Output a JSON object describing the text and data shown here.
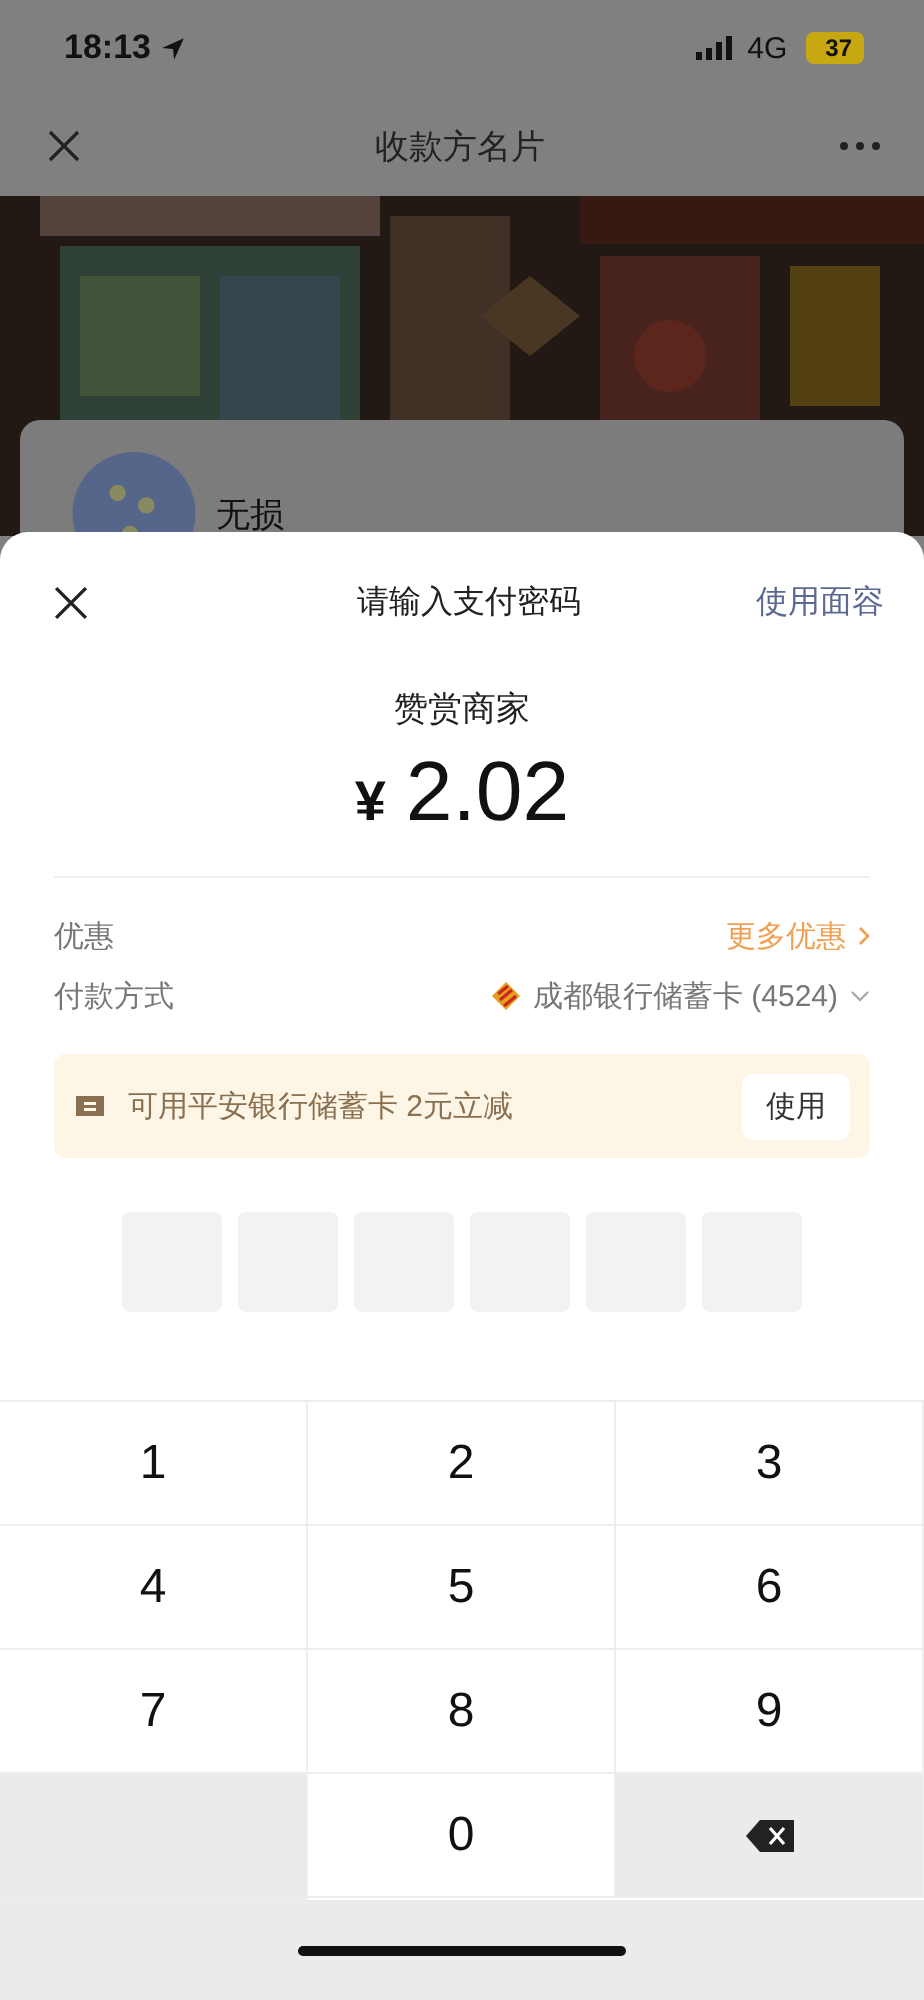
{
  "status_bar": {
    "time": "18:13",
    "network": "4G",
    "battery": "37"
  },
  "nav": {
    "title": "收款方名片"
  },
  "profile": {
    "name": "无损"
  },
  "payment_sheet": {
    "title": "请输入支付密码",
    "face_id_link": "使用面容",
    "merchant": "赞赏商家",
    "currency": "¥",
    "amount": "2.02",
    "rows": [
      {
        "kind": "discount",
        "label": "优惠",
        "value": "更多优惠"
      },
      {
        "kind": "method",
        "label": "付款方式",
        "value": "成都银行储蓄卡 (4524)"
      }
    ],
    "promo": {
      "text": "可用平安银行储蓄卡 2元立减",
      "button": "使用"
    },
    "pin": [
      {
        "filled": false
      },
      {
        "filled": false
      },
      {
        "filled": false
      },
      {
        "filled": false
      },
      {
        "filled": false
      },
      {
        "filled": false
      }
    ]
  },
  "keypad": [
    {
      "kind": "digit",
      "label": "1"
    },
    {
      "kind": "digit",
      "label": "2"
    },
    {
      "kind": "digit",
      "label": "3"
    },
    {
      "kind": "digit",
      "label": "4"
    },
    {
      "kind": "digit",
      "label": "5"
    },
    {
      "kind": "digit",
      "label": "6"
    },
    {
      "kind": "digit",
      "label": "7"
    },
    {
      "kind": "digit",
      "label": "8"
    },
    {
      "kind": "digit",
      "label": "9"
    },
    {
      "kind": "empty"
    },
    {
      "kind": "digit",
      "label": "0"
    },
    {
      "kind": "backspace"
    }
  ]
}
